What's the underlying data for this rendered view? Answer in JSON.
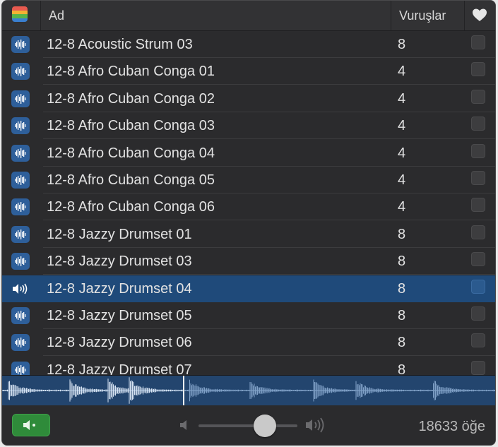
{
  "header": {
    "name_label": "Ad",
    "beats_label": "Vuruşlar"
  },
  "colors": {
    "accent_selected": "#1f4a7a",
    "preview_button": "#2f8b3a",
    "loop_icon": "#2e5f9a"
  },
  "rows": [
    {
      "name": "12-8 Acoustic Strum 03",
      "beats": "8",
      "icon": "waveform-icon"
    },
    {
      "name": "12-8 Afro Cuban Conga 01",
      "beats": "4",
      "icon": "waveform-icon"
    },
    {
      "name": "12-8 Afro Cuban Conga 02",
      "beats": "4",
      "icon": "waveform-icon"
    },
    {
      "name": "12-8 Afro Cuban Conga 03",
      "beats": "4",
      "icon": "waveform-icon"
    },
    {
      "name": "12-8 Afro Cuban Conga 04",
      "beats": "4",
      "icon": "waveform-icon"
    },
    {
      "name": "12-8 Afro Cuban Conga 05",
      "beats": "4",
      "icon": "waveform-icon"
    },
    {
      "name": "12-8 Afro Cuban Conga 06",
      "beats": "4",
      "icon": "waveform-icon"
    },
    {
      "name": "12-8 Jazzy Drumset 01",
      "beats": "8",
      "icon": "waveform-icon"
    },
    {
      "name": "12-8 Jazzy Drumset 03",
      "beats": "8",
      "icon": "waveform-icon"
    },
    {
      "name": "12-8 Jazzy Drumset 04",
      "beats": "8",
      "icon": "speaker-playing-icon",
      "selected": true
    },
    {
      "name": "12-8 Jazzy Drumset 05",
      "beats": "8",
      "icon": "waveform-icon"
    },
    {
      "name": "12-8 Jazzy Drumset 06",
      "beats": "8",
      "icon": "waveform-icon"
    },
    {
      "name": "12-8 Jazzy Drumset 07",
      "beats": "8",
      "icon": "waveform-icon"
    }
  ],
  "footer": {
    "item_count": "18633 öğe",
    "volume_level": 0.67
  }
}
